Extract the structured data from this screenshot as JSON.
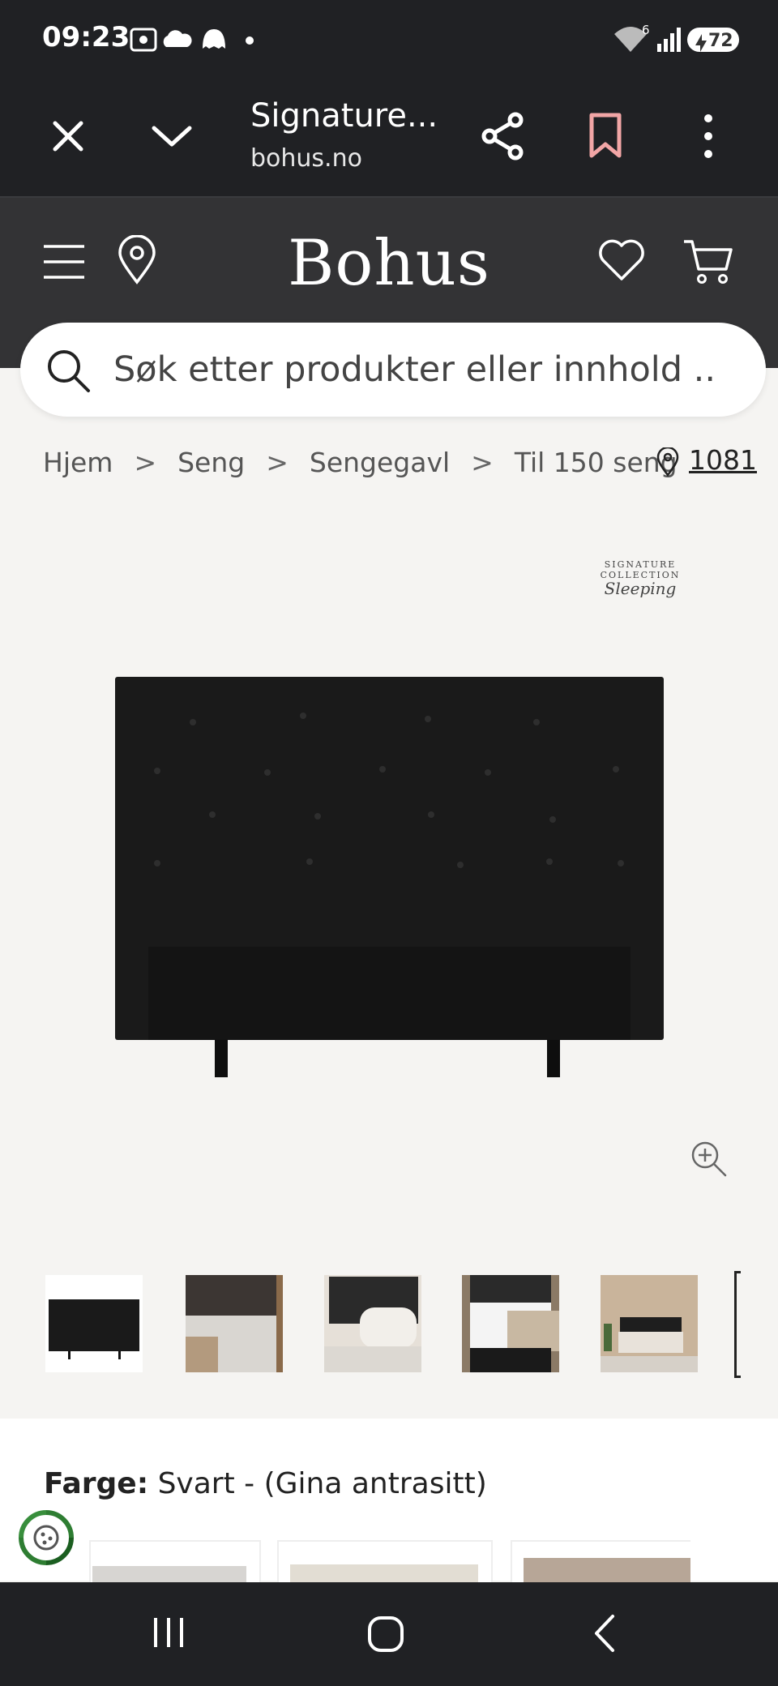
{
  "status_bar": {
    "time": "09:23",
    "battery": "72",
    "wifi_badge": "6"
  },
  "browser": {
    "title": "Signature...",
    "domain": "bohus.no"
  },
  "site": {
    "logo": "Bohus"
  },
  "search": {
    "placeholder": "Søk etter produkter eller innhold .."
  },
  "breadcrumb": {
    "items": [
      "Hjem",
      "Seng",
      "Sengegavl",
      "Til 150 seng"
    ],
    "separator": ">",
    "location_code": "1081"
  },
  "product": {
    "brand_logo_line1": "SIGNATURE COLLECTION",
    "brand_logo_line2": "Sleeping",
    "color_label": "Farge:",
    "color_value": "Svart - (Gina antrasitt)"
  },
  "colors": {
    "header_bg": "#333335",
    "chrome_bg": "#202124",
    "page_bg": "#f5f4f2",
    "bookmark": "#f2a6a6"
  },
  "thumbnails": [
    "headboard-front",
    "pillows-closeup",
    "bed-cushions",
    "bedroom-scene",
    "bedroom-wide"
  ]
}
